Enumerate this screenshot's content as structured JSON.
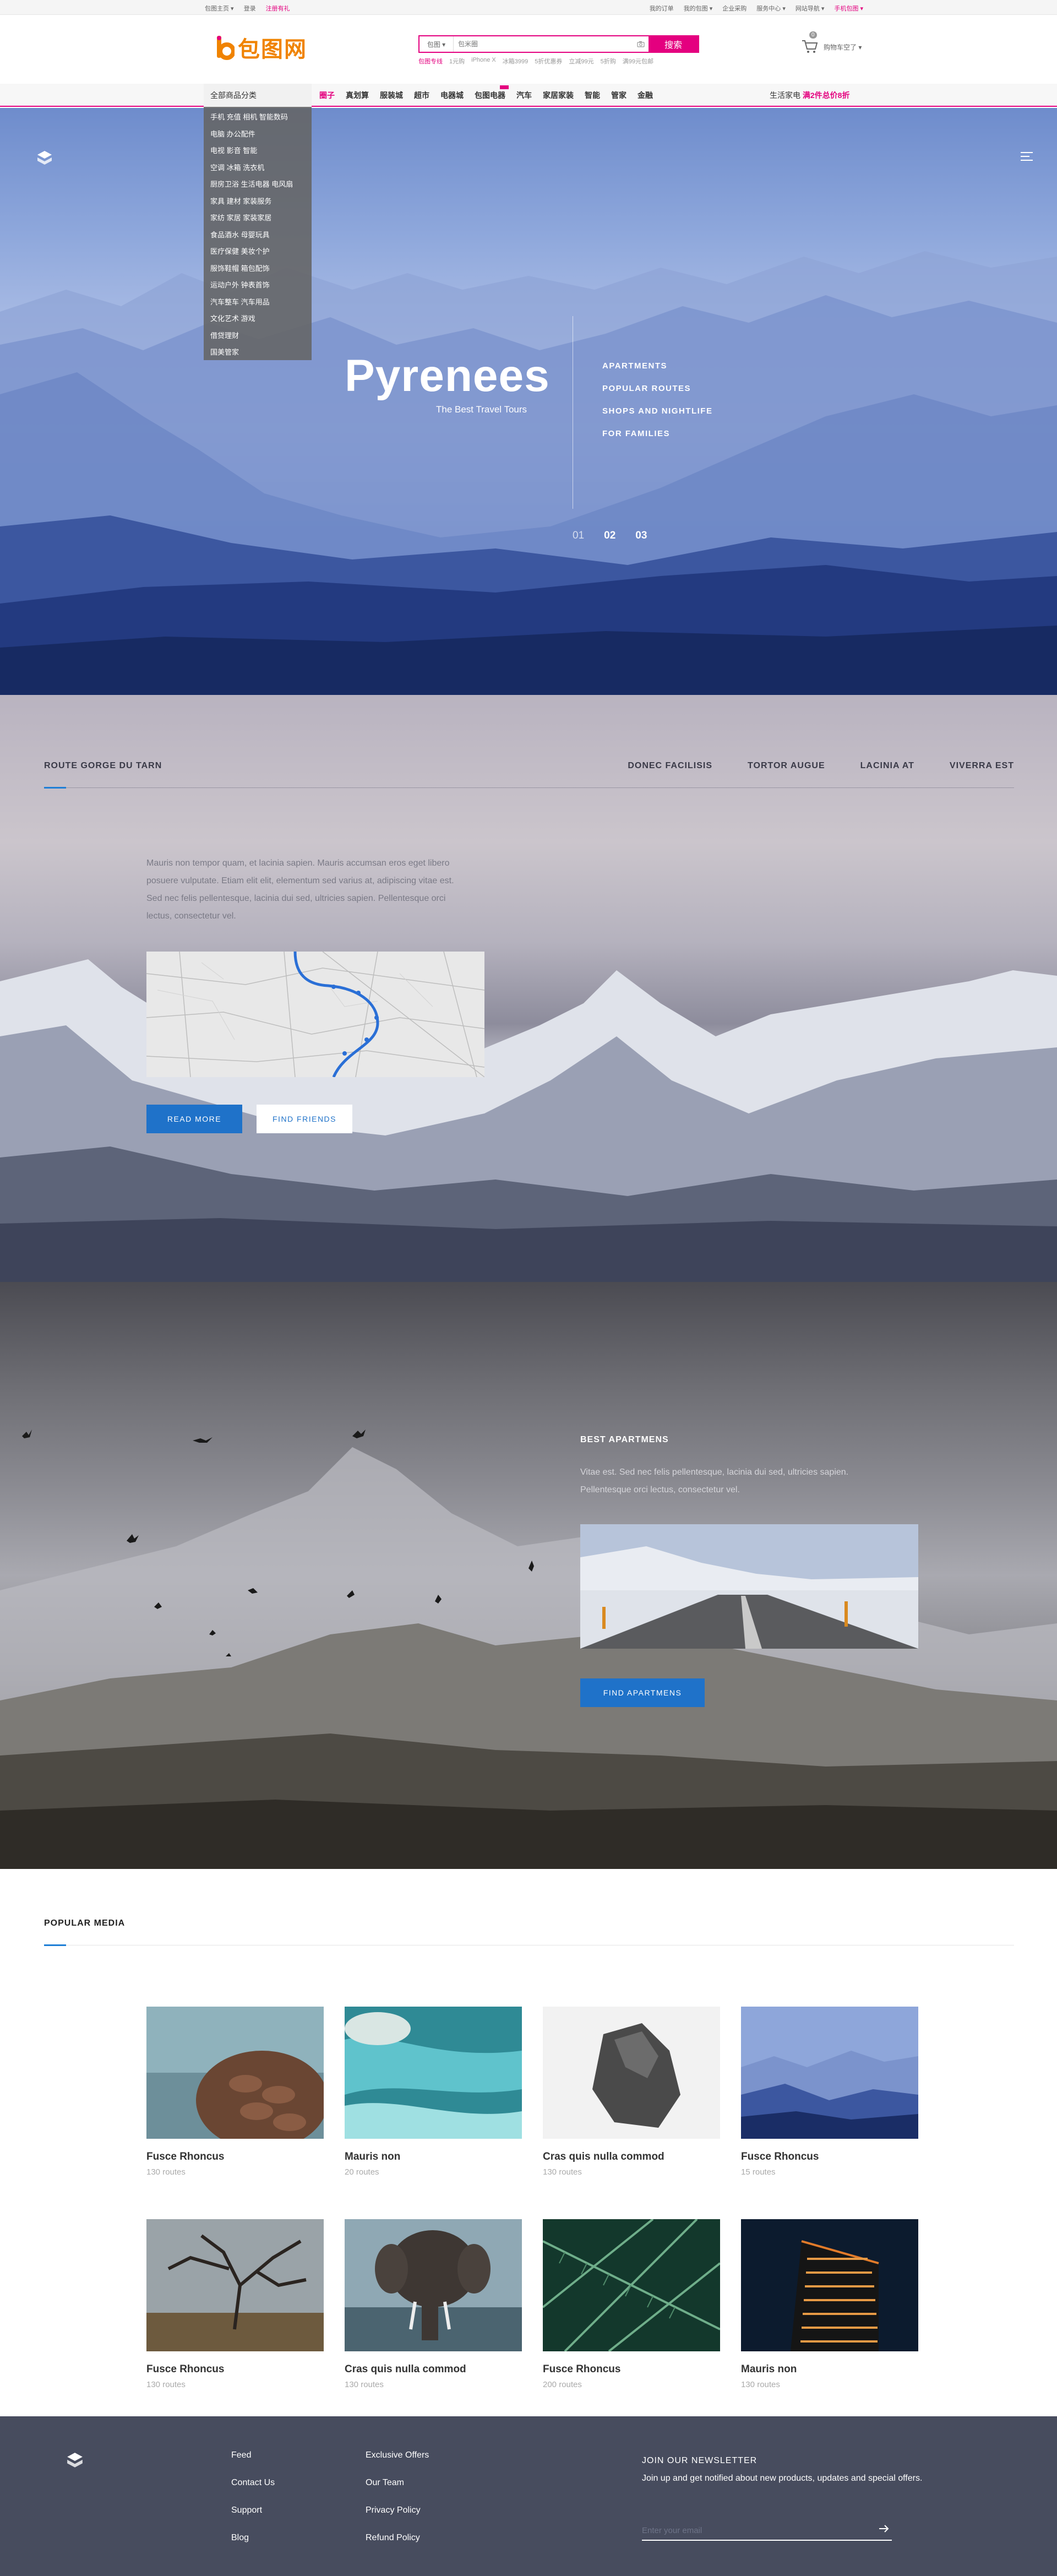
{
  "topbar": {
    "left": [
      "包图主页 ▾",
      "登录",
      "注册有礼"
    ],
    "right": [
      "我的订单",
      "我的包图 ▾",
      "企业采购",
      "服务中心 ▾",
      "网站导航 ▾",
      "手机包图 ▾"
    ]
  },
  "header": {
    "logo_text": "包图网",
    "search": {
      "scope": "包图 ▾",
      "placeholder": "包米圈",
      "button": "搜索",
      "hotwords": [
        "包图专线",
        "1元购",
        "iPhone X",
        "冰箱3999",
        "5折优惠券",
        "立减99元",
        "5折购",
        "满99元包邮"
      ]
    },
    "cart": {
      "count": "0",
      "label": "购物车空了 ▾"
    }
  },
  "nav": {
    "all_categories": "全部商品分类",
    "items": [
      "圈子",
      "真划算",
      "服装城",
      "超市",
      "电器城",
      "包图电器",
      "汽车",
      "家居家装",
      "智能",
      "管家",
      "金融"
    ],
    "promo_prefix": "生活家电",
    "promo_highlight": "满2件总价8折"
  },
  "category_menu": [
    "手机 充值 相机 智能数码",
    "电脑 办公配件",
    "电视 影音 智能",
    "空调 冰箱 洗衣机",
    "厨房卫浴 生活电器 电风扇",
    "家具 建材 家装服务",
    "家纺 家居 家装家居",
    "食品酒水 母婴玩具",
    "医疗保健 美妆个护",
    "服饰鞋帽 箱包配饰",
    "运动户外 钟表首饰",
    "汽车整车 汽车用品",
    "文化艺术 游戏",
    "借贷理财",
    "国美管家"
  ],
  "hero": {
    "title": "Pyrenees",
    "subtitle": "The Best Travel Tours",
    "links": [
      "APARTMENTS",
      "POPULAR ROUTES",
      "SHOPS AND NIGHTLIFE",
      "FOR FAMILIES"
    ],
    "pager": [
      "01",
      "02",
      "03"
    ]
  },
  "section2": {
    "title": "ROUTE GORGE DU TARN",
    "tabs": [
      "DONEC FACILISIS",
      "TORTOR AUGUE",
      "LACINIA AT",
      "VIVERRA EST"
    ],
    "text": "Mauris non tempor quam, et lacinia sapien. Mauris accumsan eros eget libero posuere vulputate. Etiam elit elit, elementum sed varius at, adipiscing vitae est. Sed nec felis pellentesque, lacinia dui sed, ultricies sapien. Pellentesque orci lectus, consectetur vel.",
    "read_more": "READ MORE",
    "find_friends": "FIND FRIENDS"
  },
  "section3": {
    "title": "BEST APARTMENS",
    "text": "Vitae est. Sed nec felis pellentesque, lacinia dui sed, ultricies sapien. Pellentesque orci lectus, consectetur vel.",
    "button": "FIND APARTMENS"
  },
  "media": {
    "title": "POPULAR MEDIA",
    "cards": [
      {
        "title": "Fusce Rhoncus",
        "sub": "130 routes"
      },
      {
        "title": "Mauris non",
        "sub": "20 routes"
      },
      {
        "title": "Cras quis nulla commod",
        "sub": "130 routes"
      },
      {
        "title": "Fusce Rhoncus",
        "sub": "15 routes"
      },
      {
        "title": "Fusce Rhoncus",
        "sub": "130 routes"
      },
      {
        "title": "Cras quis nulla commod",
        "sub": "130 routes"
      },
      {
        "title": "Fusce Rhoncus",
        "sub": "200 routes"
      },
      {
        "title": "Mauris non",
        "sub": "130 routes"
      }
    ]
  },
  "footer": {
    "col1": [
      "Feed",
      "Contact Us",
      "Support",
      "Blog"
    ],
    "col2": [
      "Exclusive Offers",
      "Our Team",
      "Privacy Policy",
      "Refund Policy"
    ],
    "newsletter_title": "JOIN OUR NEWSLETTER",
    "newsletter_text": "Join up and get notified about new products, updates and special offers.",
    "email_placeholder": "Enter your email"
  },
  "colors": {
    "brand_pink": "#e4007f",
    "brand_orange": "#f08300",
    "accent_blue": "#1f72c9",
    "footer_bg": "#474c5e"
  }
}
